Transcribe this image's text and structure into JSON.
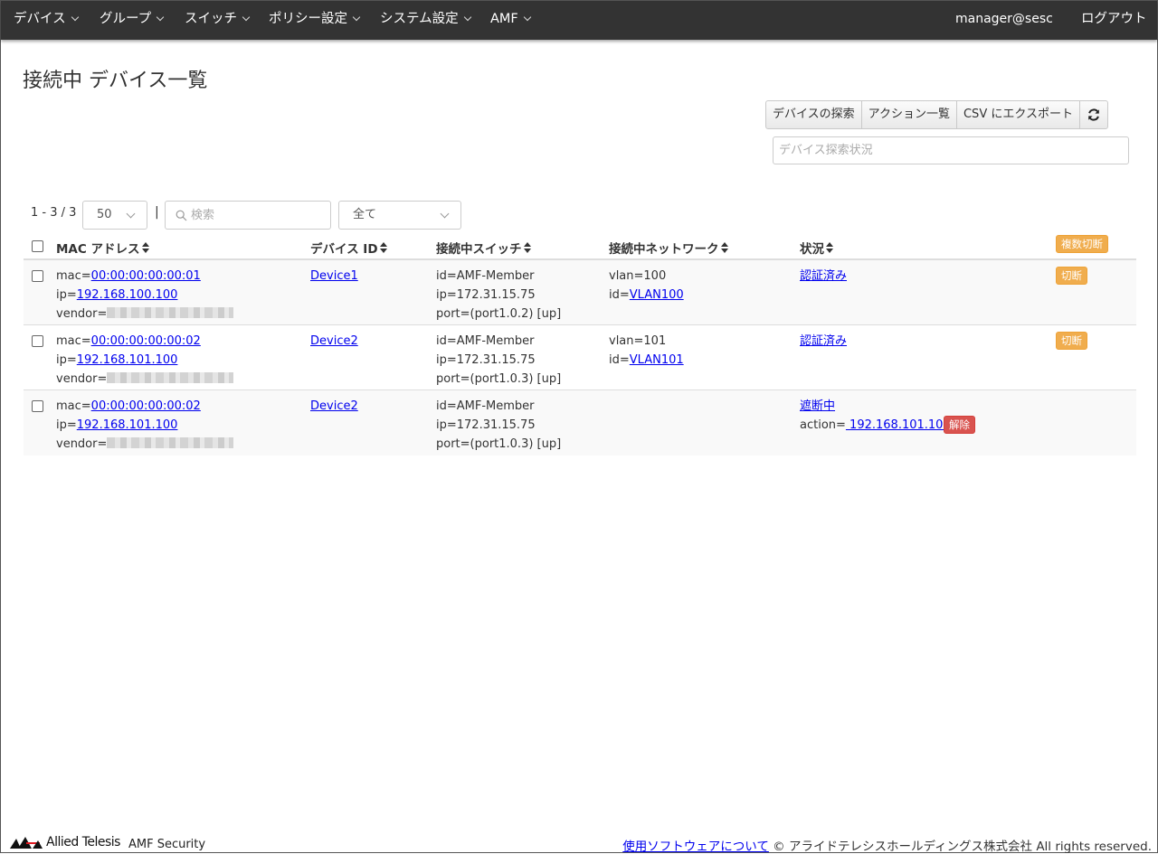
{
  "nav": {
    "items": [
      "デバイス",
      "グループ",
      "スイッチ",
      "ポリシー設定",
      "システム設定",
      "AMF"
    ],
    "user": "manager@sesc",
    "logout": "ログアウト"
  },
  "page": {
    "title": "接続中 デバイス一覧"
  },
  "actions": {
    "discover": "デバイスの探索",
    "action_list": "アクション一覧",
    "export_csv": "CSV にエクスポート",
    "refresh_icon": "refresh-icon",
    "status_placeholder": "デバイス探索状況"
  },
  "list": {
    "count": "1 - 3 / 3",
    "page_size": "50",
    "separator": "|",
    "search_placeholder": "検索",
    "filter": "全て"
  },
  "table": {
    "headers": {
      "mac": "MAC アドレス",
      "device_id": "デバイス ID",
      "switch": "接続中スイッチ",
      "network": "接続中ネットワーク",
      "status": "状況"
    },
    "bulk_disconnect": "複数切断",
    "rows": [
      {
        "mac_label": "mac=",
        "mac": "00:00:00:00:00:01",
        "ip_label": "ip=",
        "ip": "192.168.100.100",
        "vendor_label": "vendor=",
        "device_id": "Device1",
        "switch_id": "id=AMF-Member",
        "switch_ip": "ip=172.31.15.75",
        "switch_port": "port=(port1.0.2) [up]",
        "vlan": "vlan=100",
        "net_id_label": "id=",
        "net_id": "VLAN100",
        "status": "認証済み",
        "disconnect": "切断"
      },
      {
        "mac_label": "mac=",
        "mac": "00:00:00:00:00:02",
        "ip_label": "ip=",
        "ip": "192.168.101.100",
        "vendor_label": "vendor=",
        "device_id": "Device2",
        "switch_id": "id=AMF-Member",
        "switch_ip": "ip=172.31.15.75",
        "switch_port": "port=(port1.0.3) [up]",
        "vlan": "vlan=101",
        "net_id_label": "id=",
        "net_id": "VLAN101",
        "status": "認証済み",
        "disconnect": "切断"
      },
      {
        "mac_label": "mac=",
        "mac": "00:00:00:00:00:02",
        "ip_label": "ip=",
        "ip": "192.168.101.100",
        "vendor_label": "vendor=",
        "device_id": "Device2",
        "switch_id": "id=AMF-Member",
        "switch_ip": "ip=172.31.15.75",
        "switch_port": "port=(port1.0.3) [up]",
        "status": "遮断中",
        "action_label": "action=",
        "action_value": " 192.168.101.100 ",
        "release": "解除"
      }
    ]
  },
  "footer": {
    "logo_text": "Allied Telesis",
    "product": "AMF Security",
    "software_link": "使用ソフトウェアについて",
    "copyright": " © アライドテレシスホールディングス株式会社 All rights reserved."
  },
  "colors": {
    "navbar": "#333333",
    "link": "#0000ee",
    "warning": "#f0ad4e",
    "danger": "#d9534f",
    "row_stripe": "#f9f9f9"
  }
}
